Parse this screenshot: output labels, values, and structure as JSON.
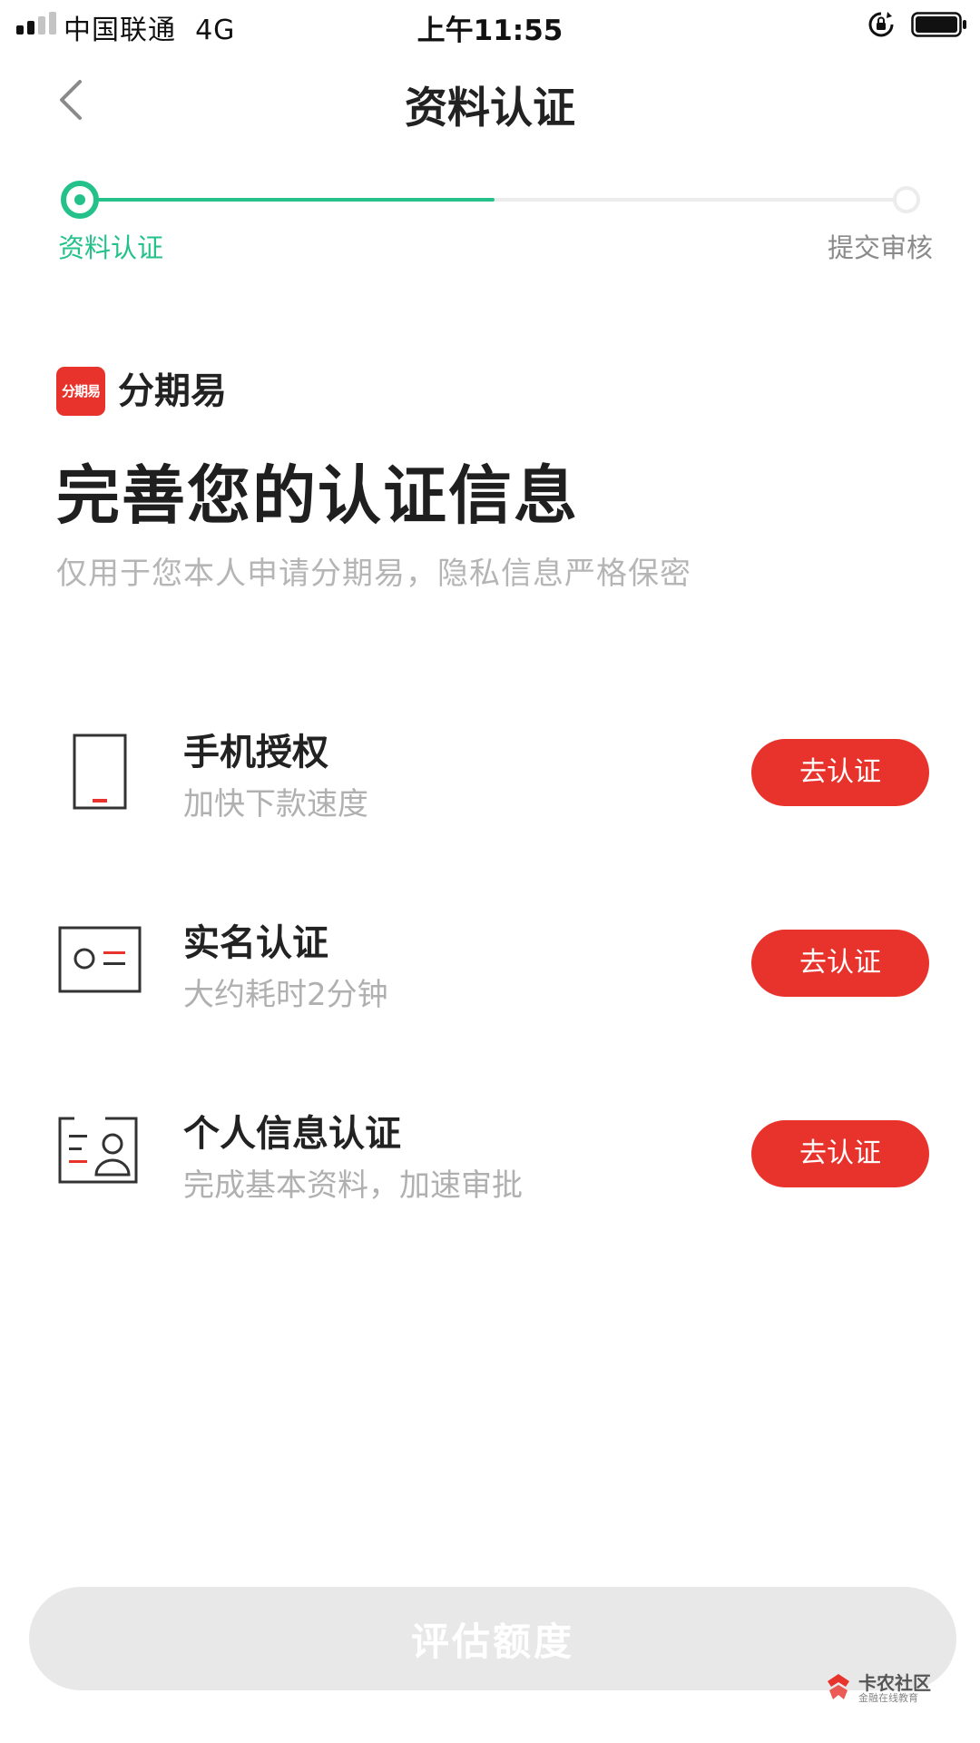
{
  "status_bar": {
    "carrier": "中国联通",
    "network": "4G",
    "time": "上午11:55"
  },
  "nav": {
    "title": "资料认证",
    "back_icon": "chevron-left-icon"
  },
  "progress": {
    "fraction_complete": 0.5,
    "steps": [
      {
        "label": "资料认证",
        "state": "active"
      },
      {
        "label": "提交审核",
        "state": "pending"
      }
    ]
  },
  "brand": {
    "logo_text": "分期易",
    "name": "分期易",
    "color": "#e8332c"
  },
  "headline": "完善您的认证信息",
  "subheadline": "仅用于您本人申请分期易，隐私信息严格保密",
  "tasks": [
    {
      "icon": "phone-icon",
      "title": "手机授权",
      "subtitle": "加快下款速度",
      "button": "去认证"
    },
    {
      "icon": "id-card-icon",
      "title": "实名认证",
      "subtitle": "大约耗时2分钟",
      "button": "去认证"
    },
    {
      "icon": "profile-card-icon",
      "title": "个人信息认证",
      "subtitle": "完成基本资料，加速审批",
      "button": "去认证"
    }
  ],
  "cta": {
    "label": "评估额度",
    "enabled": false
  },
  "watermark": {
    "name": "卡农社区",
    "tagline": "金融在线教育"
  },
  "colors": {
    "accent_green": "#24c28a",
    "brand_red": "#e8332c",
    "disabled_gray": "#e8e8e8"
  }
}
